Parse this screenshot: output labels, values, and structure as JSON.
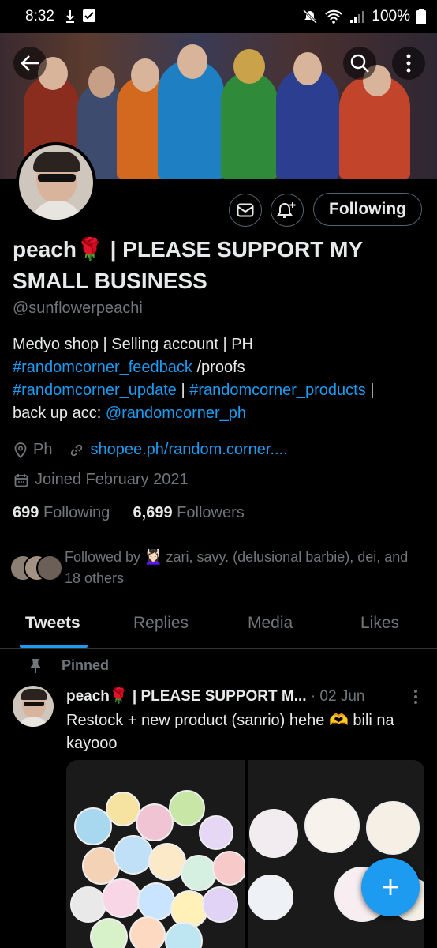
{
  "status_bar": {
    "time": "8:32",
    "battery": "100%"
  },
  "profile": {
    "name": "peach🌹 | PLEASE SUPPORT MY SMALL BUSINESS",
    "handle": "@sunflowerpeachi",
    "bio_line1": "Medyo shop | Selling account | PH",
    "bio_tag_feedback": "#randomcorner_feedback",
    "bio_proofs": " /proofs",
    "bio_tag_update": "#randomcorner_update",
    "bio_sep": " | ",
    "bio_tag_products": "#randomcorner_products",
    "bio_sep2": " |",
    "bio_backup_label": "back up acc: ",
    "bio_backup_handle": "@randomcorner_ph",
    "location": "Ph",
    "website": "shopee.ph/random.corner....",
    "joined": "Joined February 2021",
    "following_count": "699",
    "following_label": "Following",
    "followers_count": "6,699",
    "followers_label": "Followers",
    "followed_by": "Followed by 💆🏻‍♀️ zari, savy. (delusional barbie), dei, and 18 others",
    "follow_button": "Following"
  },
  "tabs": [
    {
      "label": "Tweets",
      "active": true
    },
    {
      "label": "Replies"
    },
    {
      "label": "Media"
    },
    {
      "label": "Likes"
    }
  ],
  "tweet": {
    "pinned_label": "Pinned",
    "author": "peach🌹 | PLEASE SUPPORT M...",
    "date": "· 02 Jun",
    "text": "Restock + new product (sanrio) hehe 🫶 bili na kayooo"
  },
  "icons": {
    "back": "back-arrow-icon",
    "search": "search-icon",
    "more": "more-vertical-icon",
    "message": "mail-icon",
    "notify": "bell-plus-icon",
    "compose": "plus-icon"
  },
  "colors": {
    "accent": "#1d9bf0",
    "text": "#e7e9ea",
    "muted": "#71767b",
    "background": "#000000"
  }
}
